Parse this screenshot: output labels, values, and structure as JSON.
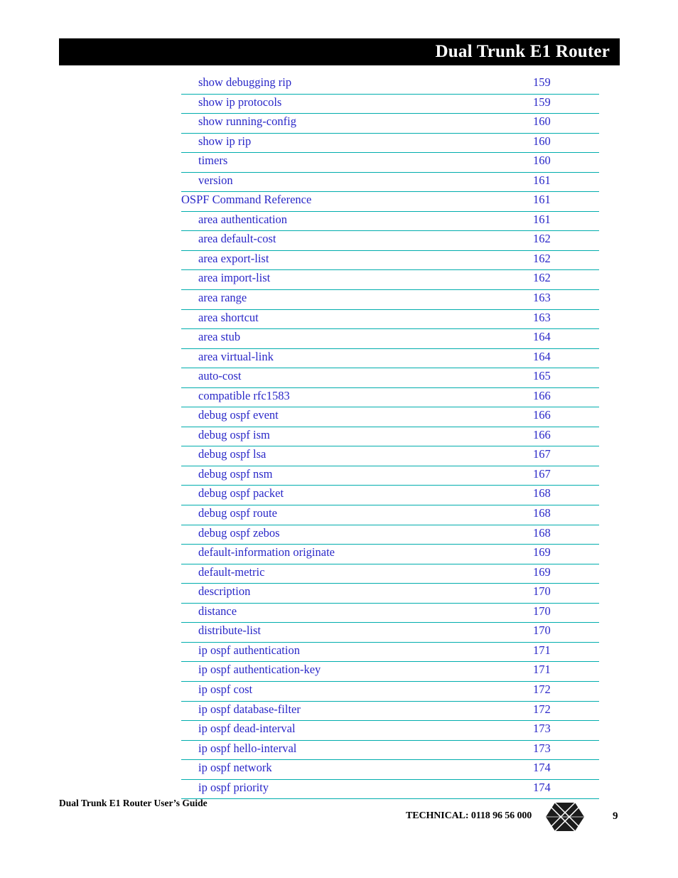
{
  "header": {
    "title": "Dual Trunk E1 Router"
  },
  "toc": {
    "entries": [
      {
        "label": "show debugging rip",
        "page": "159",
        "level": 2
      },
      {
        "label": "show ip protocols",
        "page": "159",
        "level": 2
      },
      {
        "label": "show running-config",
        "page": "160",
        "level": 2
      },
      {
        "label": "show ip rip",
        "page": "160",
        "level": 2
      },
      {
        "label": "timers",
        "page": "160",
        "level": 2
      },
      {
        "label": "version",
        "page": "161",
        "level": 2
      },
      {
        "label": "OSPF Command Reference",
        "page": "161",
        "level": 1
      },
      {
        "label": "area authentication",
        "page": "161",
        "level": 2
      },
      {
        "label": "area default-cost",
        "page": "162",
        "level": 2
      },
      {
        "label": "area export-list",
        "page": "162",
        "level": 2
      },
      {
        "label": "area import-list",
        "page": "162",
        "level": 2
      },
      {
        "label": "area range",
        "page": "163",
        "level": 2
      },
      {
        "label": "area shortcut",
        "page": "163",
        "level": 2
      },
      {
        "label": "area stub",
        "page": "164",
        "level": 2
      },
      {
        "label": "area virtual-link",
        "page": "164",
        "level": 2
      },
      {
        "label": "auto-cost",
        "page": "165",
        "level": 2
      },
      {
        "label": "compatible rfc1583",
        "page": "166",
        "level": 2
      },
      {
        "label": "debug ospf event",
        "page": "166",
        "level": 2
      },
      {
        "label": "debug ospf ism",
        "page": "166",
        "level": 2
      },
      {
        "label": "debug ospf lsa",
        "page": "167",
        "level": 2
      },
      {
        "label": "debug ospf nsm",
        "page": "167",
        "level": 2
      },
      {
        "label": "debug ospf packet",
        "page": "168",
        "level": 2
      },
      {
        "label": "debug ospf route",
        "page": "168",
        "level": 2
      },
      {
        "label": "debug ospf zebos",
        "page": "168",
        "level": 2
      },
      {
        "label": "default-information originate",
        "page": "169",
        "level": 2
      },
      {
        "label": "default-metric",
        "page": "169",
        "level": 2
      },
      {
        "label": "description",
        "page": "170",
        "level": 2
      },
      {
        "label": "distance",
        "page": "170",
        "level": 2
      },
      {
        "label": "distribute-list",
        "page": "170",
        "level": 2
      },
      {
        "label": "ip ospf authentication",
        "page": "171",
        "level": 2
      },
      {
        "label": "ip ospf authentication-key",
        "page": "171",
        "level": 2
      },
      {
        "label": "ip ospf cost",
        "page": "172",
        "level": 2
      },
      {
        "label": "ip ospf database-filter",
        "page": "172",
        "level": 2
      },
      {
        "label": "ip ospf dead-interval",
        "page": "173",
        "level": 2
      },
      {
        "label": "ip ospf hello-interval",
        "page": "173",
        "level": 2
      },
      {
        "label": "ip ospf network",
        "page": "174",
        "level": 2
      },
      {
        "label": "ip ospf priority",
        "page": "174",
        "level": 2
      }
    ]
  },
  "footer": {
    "guide_title": "Dual Trunk E1 Router User’s Guide",
    "technical": "TECHNICAL:  0118 96 56 000",
    "page_number": "9",
    "logo_name": "hexagon-diamond-logo"
  },
  "colors": {
    "link_text": "#2A28C8",
    "rule": "#00ADAD",
    "header_bar": "#000000",
    "header_text": "#FFFFFF"
  }
}
